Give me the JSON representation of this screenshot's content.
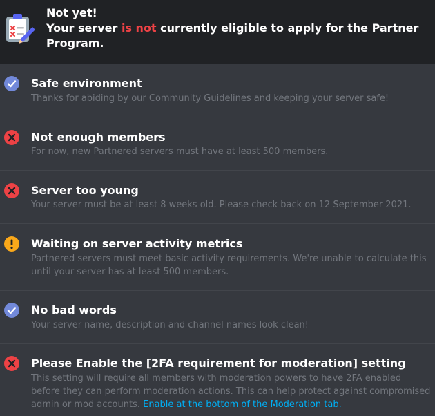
{
  "header": {
    "title": "Not yet!",
    "line_prefix": "Your server ",
    "line_emphasis": "is not",
    "line_suffix": " currently eligible to apply for the Partner Program.",
    "icon": "clipboard-checklist-icon",
    "emphasis_color": "#ed4245"
  },
  "colors": {
    "pass": "#7289da",
    "fail": "#ed4245",
    "warning": "#faa81a",
    "link": "#00aff4"
  },
  "requirements": [
    {
      "status": "pass",
      "icon": "check-circle-icon",
      "title": "Safe environment",
      "description": "Thanks for abiding by our Community Guidelines and keeping your server safe!"
    },
    {
      "status": "fail",
      "icon": "x-circle-icon",
      "title": "Not enough members",
      "description": "For now, new Partnered servers must have at least 500 members."
    },
    {
      "status": "fail",
      "icon": "x-circle-icon",
      "title": "Server too young",
      "description": "Your server must be at least 8 weeks old. Please check back on 12 September 2021."
    },
    {
      "status": "warning",
      "icon": "exclamation-circle-icon",
      "title": "Waiting on server activity metrics",
      "description": "Partnered servers must meet basic activity requirements. We're unable to calculate this until your server has at least 500 members."
    },
    {
      "status": "pass",
      "icon": "check-circle-icon",
      "title": "No bad words",
      "description": "Your server name, description and channel names look clean!"
    },
    {
      "status": "fail",
      "icon": "x-circle-icon",
      "title": "Please Enable the [2FA requirement for moderation] setting",
      "description": "This setting will require all members with moderation powers to have 2FA enabled before they can perform moderation actions. This can help protect against compromised admin or mod accounts. ",
      "link": "Enable at the bottom of the Moderation tab."
    }
  ]
}
